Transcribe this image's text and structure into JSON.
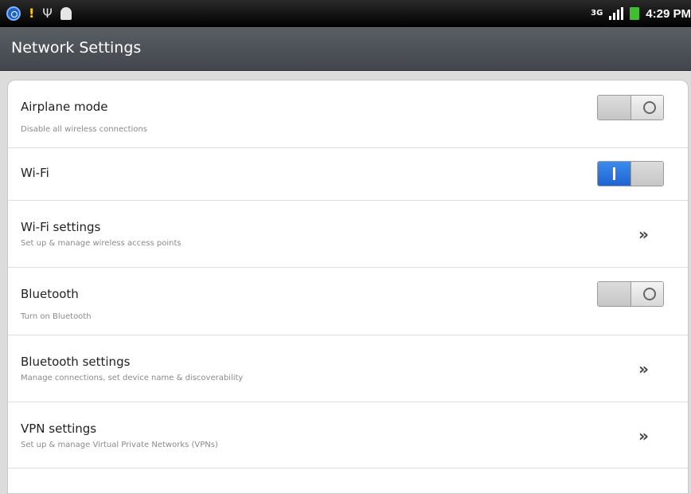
{
  "status_bar": {
    "time": "4:29 PM",
    "network": "3G",
    "icons_left": [
      "gps-icon",
      "warning-icon",
      "usb-icon",
      "android-debug-icon"
    ],
    "icons_right": [
      "3g-icon",
      "signal-icon",
      "battery-icon"
    ]
  },
  "header": {
    "title": "Network Settings"
  },
  "colors": {
    "toggle_on": "#1e64d2",
    "title_bar": "#4b4f54"
  },
  "settings": [
    {
      "title": "Airplane mode",
      "subtitle": "Disable all wireless connections",
      "control": "toggle",
      "on": false
    },
    {
      "title": "Wi-Fi",
      "subtitle": "",
      "control": "toggle",
      "on": true
    },
    {
      "title": "Wi-Fi settings",
      "subtitle": "Set up & manage wireless access points",
      "control": "chevron"
    },
    {
      "title": "Bluetooth",
      "subtitle": "Turn on Bluetooth",
      "control": "toggle",
      "on": false
    },
    {
      "title": "Bluetooth settings",
      "subtitle": "Manage connections, set device name & discoverability",
      "control": "chevron"
    },
    {
      "title": "VPN settings",
      "subtitle": "Set up & manage Virtual Private Networks (VPNs)",
      "control": "chevron"
    }
  ]
}
